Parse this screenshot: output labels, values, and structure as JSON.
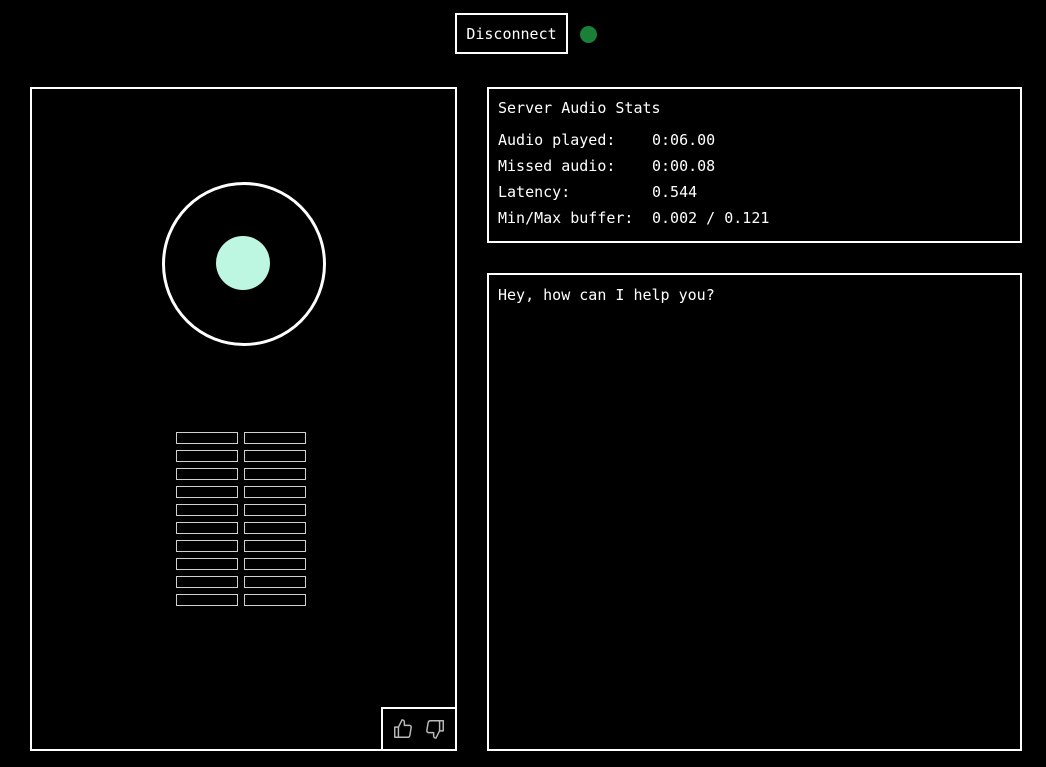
{
  "header": {
    "disconnect_label": "Disconnect"
  },
  "colors": {
    "status_dot": "#1a7f37",
    "audio_ball": "#bdf7e1"
  },
  "visualizer": {
    "icon": "audio-level-ring",
    "meter_rows": 10,
    "meter_columns": 2
  },
  "feedback": {
    "thumbs_up_icon": "thumbs-up-icon",
    "thumbs_down_icon": "thumbs-down-icon"
  },
  "stats": {
    "title": "Server Audio Stats",
    "rows": [
      {
        "label": "Audio played:",
        "value": "0:06.00"
      },
      {
        "label": "Missed audio:",
        "value": "0:00.08"
      },
      {
        "label": "Latency:",
        "value": "0.544"
      },
      {
        "label": "Min/Max buffer:",
        "value": "0.002 / 0.121"
      }
    ]
  },
  "chat": {
    "messages": [
      "Hey, how can I help you?"
    ]
  }
}
